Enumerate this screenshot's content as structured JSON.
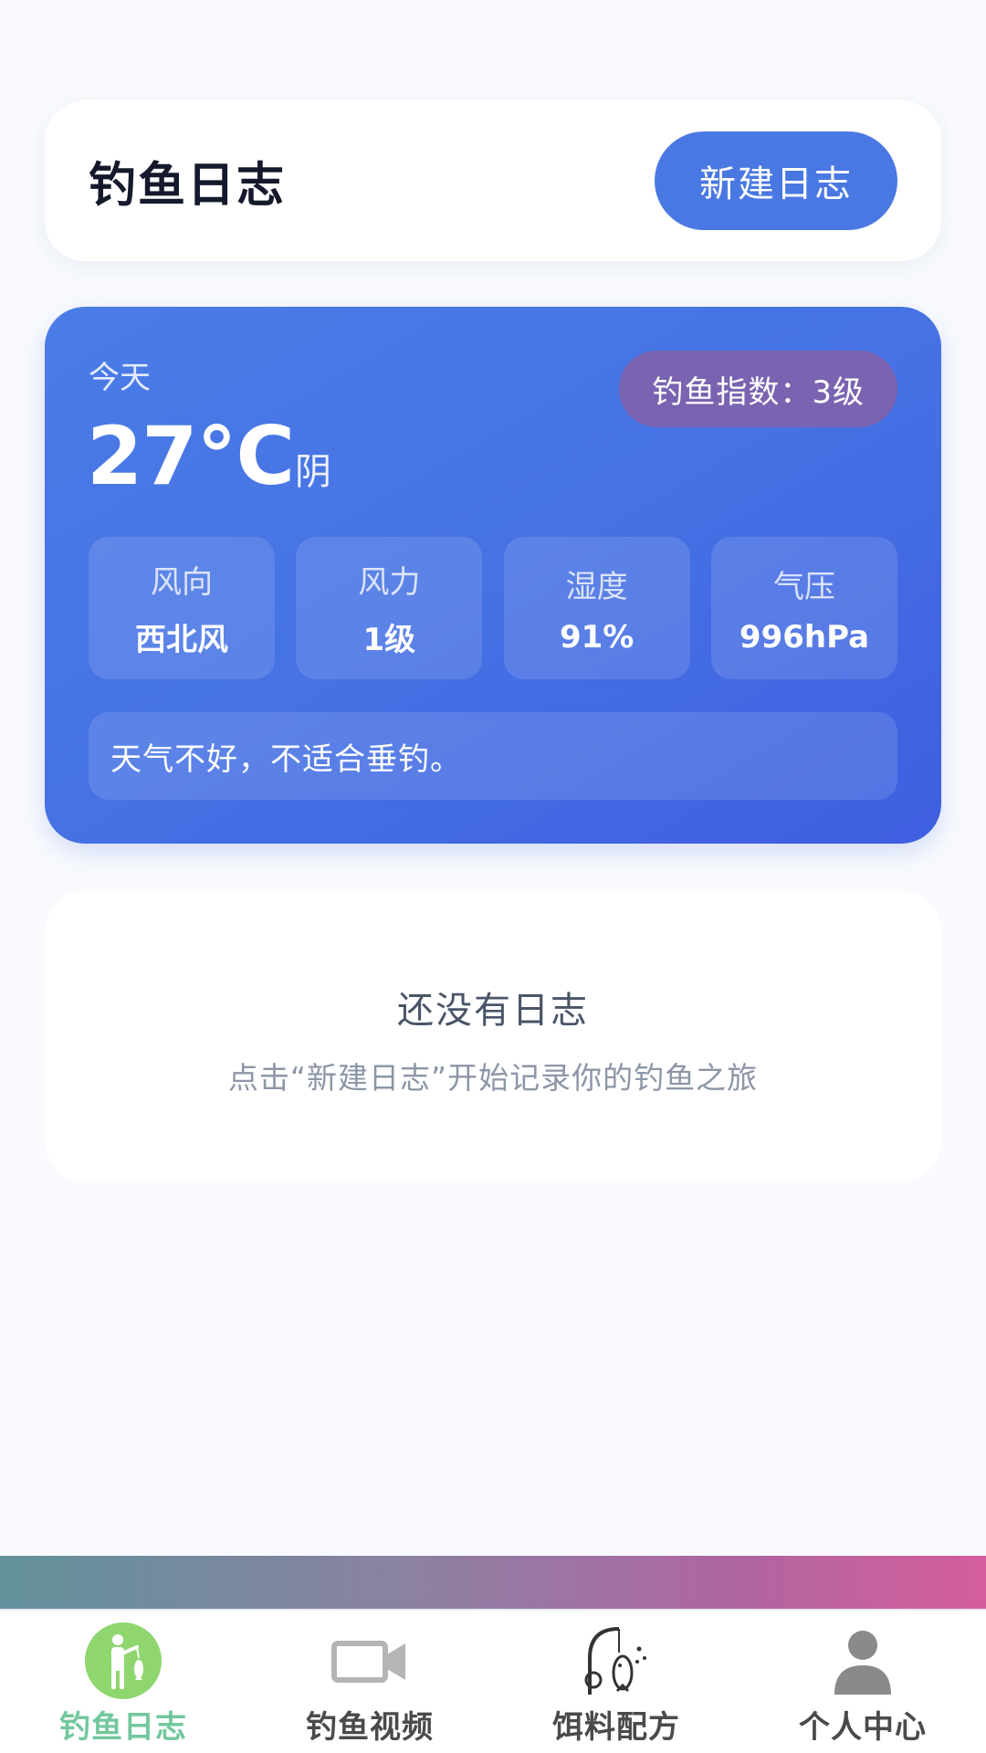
{
  "header": {
    "title": "钓鱼日志",
    "new_log_label": "新建日志"
  },
  "weather": {
    "day_label": "今天",
    "temperature": "27°C",
    "condition": "阴",
    "fishing_index": "钓鱼指数：3级",
    "stats": [
      {
        "label": "风向",
        "value": "西北风"
      },
      {
        "label": "风力",
        "value": "1级"
      },
      {
        "label": "湿度",
        "value": "91%"
      },
      {
        "label": "气压",
        "value": "996hPa"
      }
    ],
    "advice": "天气不好，不适合垂钓。"
  },
  "empty_state": {
    "title": "还没有日志",
    "subtitle": "点击“新建日志”开始记录你的钓鱼之旅"
  },
  "tabs": [
    {
      "label": "钓鱼日志",
      "icon": "fisherman-icon",
      "active": true
    },
    {
      "label": "钓鱼视频",
      "icon": "video-camera-icon",
      "active": false
    },
    {
      "label": "饵料配方",
      "icon": "fishing-reel-fish-icon",
      "active": false
    },
    {
      "label": "个人中心",
      "icon": "user-icon",
      "active": false
    }
  ],
  "colors": {
    "accent": "#4a78e3",
    "weather_card": "#4672e4",
    "index_badge": "#7a63b0",
    "active_tab": "#72c79d",
    "active_tab_icon_bg": "#8fd66e"
  }
}
